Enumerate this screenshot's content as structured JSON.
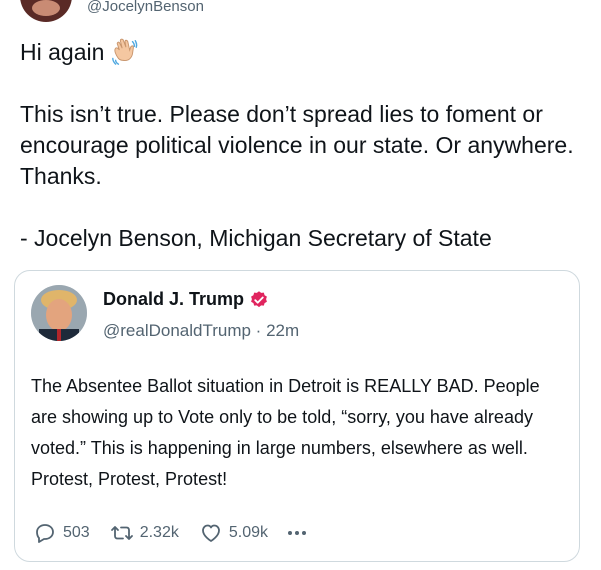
{
  "author": {
    "handle": "@JocelynBenson"
  },
  "tweet": {
    "line1": "Hi again",
    "para2": "This isn’t true. Please don’t spread lies to foment or encourage political violence in our state. Or anywhere. Thanks.",
    "para3": "- Jocelyn Benson, Michigan Secretary of State"
  },
  "quoted": {
    "name": "Donald J. Trump",
    "meta": "@realDonaldTrump · 22m",
    "text": "The Absentee Ballot situation in Detroit is REALLY BAD. People are showing up to Vote only to be told, “sorry, you have already voted.” This is happening in large numbers, elsewhere as well. Protest, Protest, Protest!",
    "replies": "503",
    "retweets": "2.32k",
    "likes": "5.09k"
  },
  "icons": {
    "wave": "waving-hand-icon",
    "verified": "verified-badge-icon",
    "reply": "reply-icon",
    "retweet": "retweet-icon",
    "like": "heart-icon",
    "more": "more-icon"
  },
  "colors": {
    "verified": "#e0245e",
    "text": "#0f1419",
    "muted": "#536471",
    "border": "#cfd9de"
  }
}
